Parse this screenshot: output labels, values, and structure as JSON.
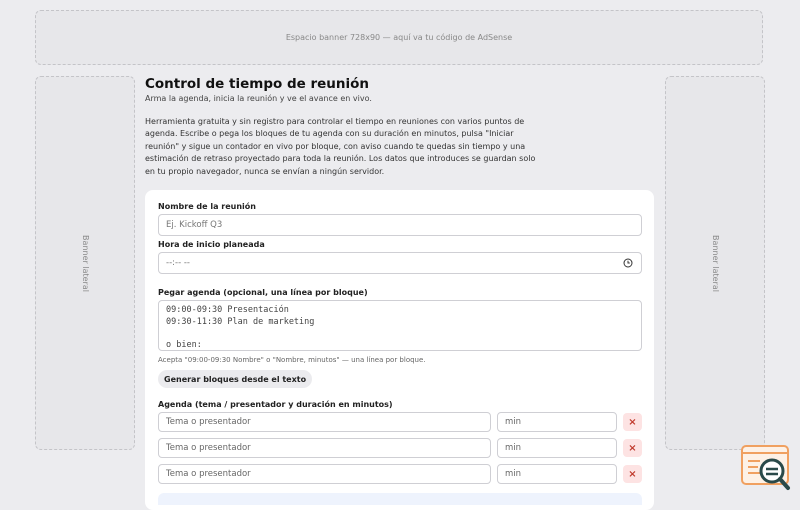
{
  "banners": {
    "top": "Espacio banner 728x90 — aquí va tu código de AdSense",
    "left": "Banner lateral",
    "right": "Banner lateral"
  },
  "page": {
    "title": "Control de tiempo de reunión",
    "subtitle": "Arma la agenda, inicia la reunión y ve el avance en vivo.",
    "description": "Herramienta gratuita y sin registro para controlar el tiempo en reuniones con varios puntos de agenda. Escribe o pega los bloques de tu agenda con su duración en minutos, pulsa \"Iniciar reunión\" y sigue un contador en vivo por bloque, con aviso cuando te quedas sin tiempo y una estimación de retraso proyectado para toda la reunión. Los datos que introduces se guardan solo en tu propio navegador, nunca se envían a ningún servidor."
  },
  "form": {
    "meeting_name_label": "Nombre de la reunión",
    "meeting_name_placeholder": "Ej. Kickoff Q3",
    "start_time_label": "Hora de inicio planeada",
    "start_time_value": "--:-- --",
    "paste_label": "Pegar agenda (opcional, una línea por bloque)",
    "paste_placeholder": "09:00-09:30 Presentación\n09:30-11:30 Plan de marketing\n\no bien:",
    "paste_hint": "Acepta \"09:00-09:30 Nombre\" o \"Nombre, minutos\" — una línea por bloque.",
    "generate_button": "Generar bloques desde el texto",
    "agenda_label": "Agenda (tema / presentador y duración en minutos)"
  },
  "agenda_rows": [
    {
      "topic_placeholder": "Tema o presentador",
      "min_placeholder": "min",
      "delete": "×"
    },
    {
      "topic_placeholder": "Tema o presentador",
      "min_placeholder": "min",
      "delete": "×"
    },
    {
      "topic_placeholder": "Tema o presentador",
      "min_placeholder": "min",
      "delete": "×"
    }
  ],
  "colors": {
    "background": "#ececef",
    "card": "#ffffff",
    "delete_bg": "#fde3e3",
    "delete_fg": "#c0392b",
    "logo_orange": "#f0a060",
    "logo_teal": "#2a4a4a"
  }
}
